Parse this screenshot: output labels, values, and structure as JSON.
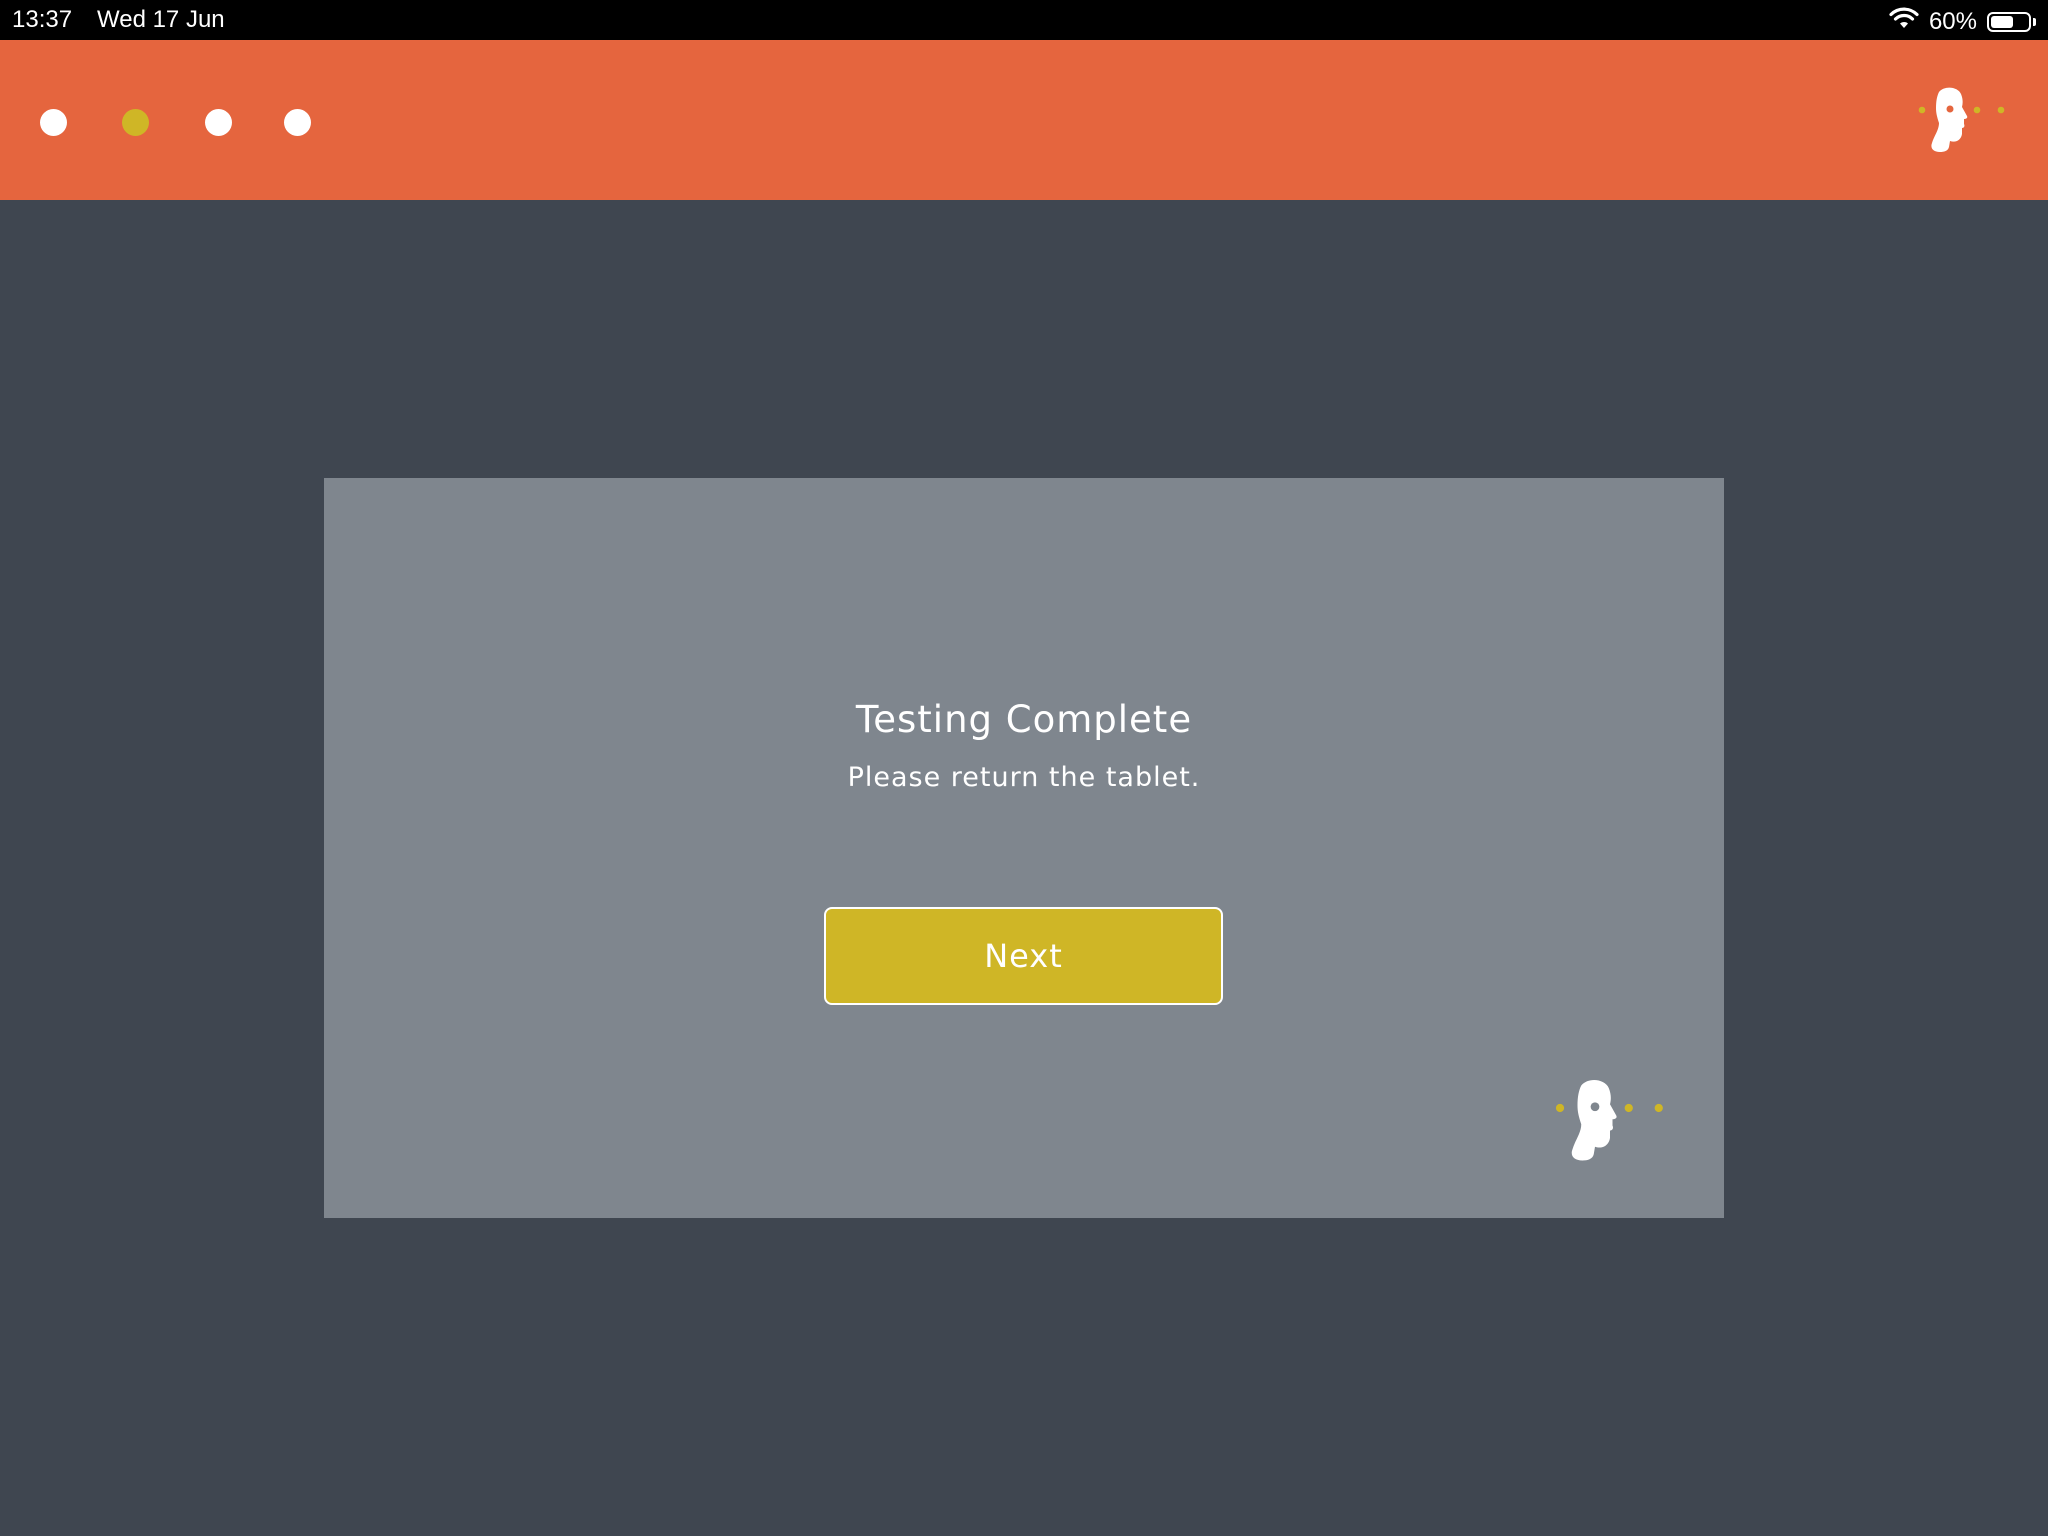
{
  "status_bar": {
    "time": "13:37",
    "date": "Wed 17 Jun",
    "battery_percent": "60%",
    "battery_level": 0.6,
    "icons": [
      "wifi-icon",
      "battery-icon"
    ]
  },
  "header": {
    "background_color": "#e5653e",
    "progress": {
      "total_steps": 4,
      "current_step": 2,
      "active_color": "#cfb626",
      "inactive_color": "#ffffff"
    },
    "logo_icon": "head-profile-logo-icon"
  },
  "card": {
    "title": "Testing Complete",
    "subtitle": "Please return the tablet.",
    "next_label": "Next",
    "button_color": "#cfb626",
    "logo_icon": "head-profile-logo-icon"
  },
  "colors": {
    "page_background": "#3f4650",
    "card_background": "#7f868e",
    "accent": "#cfb626"
  }
}
